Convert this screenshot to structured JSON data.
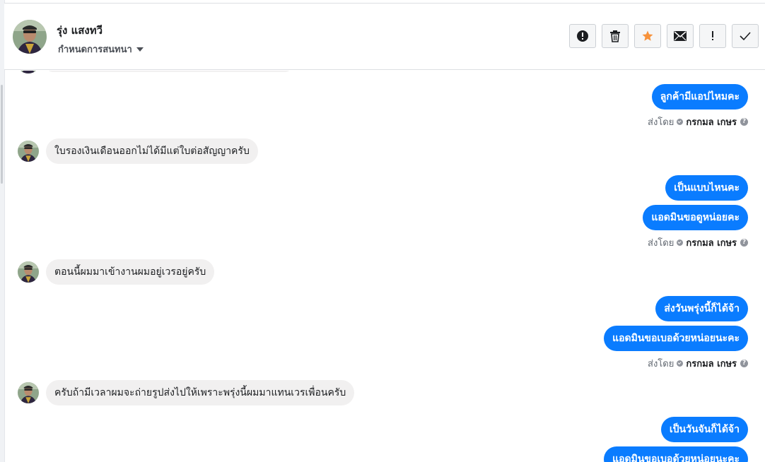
{
  "header": {
    "contact_name": "รุ่ง แสงทวี",
    "status_label": "กำหนดการสนทนา",
    "avatar_icon": "person-photo-avatar",
    "actions": [
      {
        "name": "spam-button",
        "icon": "exclamation-circle-icon",
        "symbol": "!"
      },
      {
        "name": "delete-button",
        "icon": "trash-icon",
        "symbol": ""
      },
      {
        "name": "star-button",
        "icon": "star-icon",
        "symbol": "★"
      },
      {
        "name": "mark-unread-button",
        "icon": "envelope-icon",
        "symbol": ""
      },
      {
        "name": "follow-up-button",
        "icon": "exclamation-icon",
        "symbol": "!"
      },
      {
        "name": "done-button",
        "icon": "checkmark-icon",
        "symbol": "✓"
      }
    ]
  },
  "colors": {
    "outgoing_bubble": "#0a7cff",
    "incoming_bubble": "#f1f0f0",
    "star": "#f7923b"
  },
  "messages": {
    "out_1": "ลูกค้ามีแอปไหมคะ",
    "in_1": "ใบรองเงินเดือนออกไม่ได้มีแต่ใบต่อสัญญาครับ",
    "out_2a": "เป็นแบบไหนคะ",
    "out_2b": "แอดมินขอดูหน่อยคะ",
    "in_2": "ตอนนี้ผมมาเข้างานผมอยู่เวรอยู่ครับ",
    "out_3a": "ส่งวันพรุ่งนี้ก็ได้จ้า",
    "out_3b": "แอดมินขอเบอด้วยหน่อยนะคะ",
    "in_3": "ครับถ้ามีเวลาผมจะถ่ายรูปส่งไปให้เพราะพรุ่งนี้ผมมาแทนเวรเพื่อนครับ",
    "out_4a": "เป็นวันจันก็ได้จ้า",
    "out_4b": "แอดมินขอเบอด้วยหน่อยนะคะ"
  },
  "sent_by": {
    "prefix": "ส่งโดย",
    "agent": "กรกมล เกษร",
    "help": "?"
  }
}
